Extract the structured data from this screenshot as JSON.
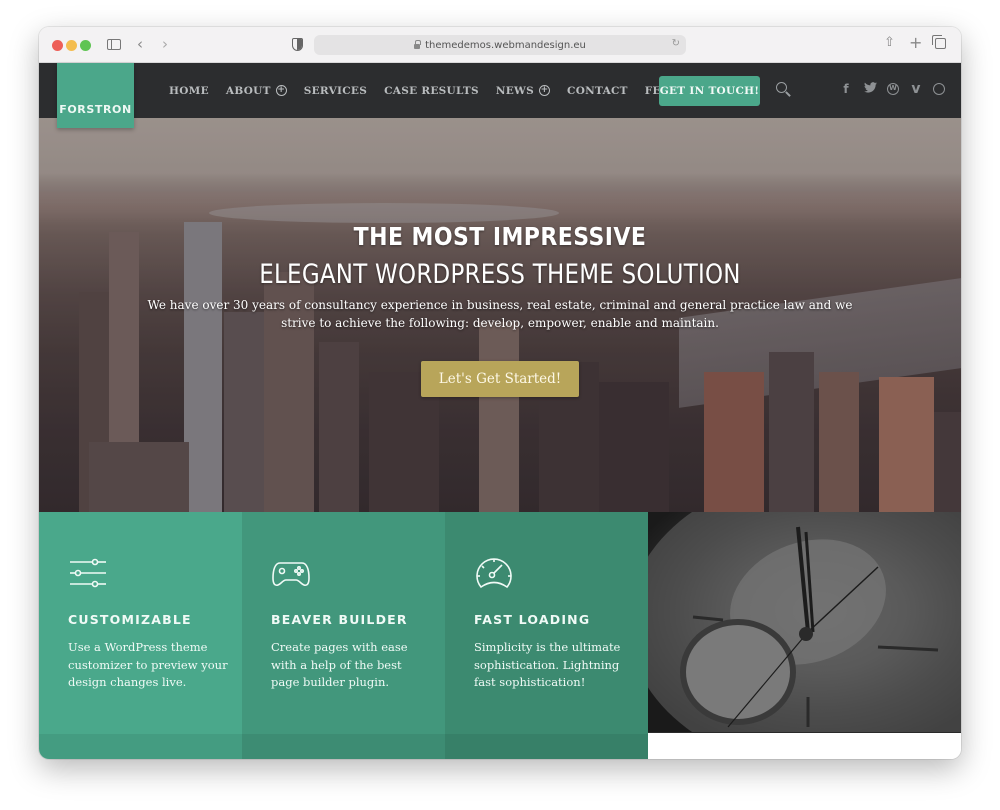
{
  "browser": {
    "url": "themedemos.webmandesign.eu",
    "icons": {
      "sidebar": "sidebar-toggle-icon",
      "back": "chevron-left-icon",
      "forward": "chevron-right-icon",
      "privacy": "shield-icon",
      "lock": "lock-icon",
      "reload": "reload-icon",
      "share": "share-icon",
      "new_tab": "plus-icon",
      "tabs": "tabs-overview-icon"
    },
    "glyphs": {
      "back": "‹",
      "forward": "›",
      "reload": "↻",
      "share": "⇧",
      "new_tab": "+"
    }
  },
  "header": {
    "logo": "FORSTRON",
    "nav": [
      {
        "label": "HOME",
        "has_submenu": false
      },
      {
        "label": "ABOUT",
        "has_submenu": true
      },
      {
        "label": "SERVICES",
        "has_submenu": false
      },
      {
        "label": "CASE RESULTS",
        "has_submenu": false
      },
      {
        "label": "NEWS",
        "has_submenu": true
      },
      {
        "label": "CONTACT",
        "has_submenu": false
      },
      {
        "label": "FEATURES",
        "has_submenu": true
      }
    ],
    "submenu_glyph": "+",
    "cta": "GET IN TOUCH!",
    "social": [
      {
        "name": "facebook",
        "glyph": "f"
      },
      {
        "name": "twitter",
        "glyph": "🐦"
      },
      {
        "name": "wordpress",
        "glyph": "W"
      },
      {
        "name": "vimeo",
        "glyph": "v"
      },
      {
        "name": "website",
        "glyph": "◎"
      }
    ]
  },
  "hero": {
    "title_line1": "THE MOST IMPRESSIVE",
    "title_line2": "ELEGANT WORDPRESS THEME SOLUTION",
    "text": "We have over 30 years of consultancy experience in business, real estate, criminal and general practice law and we strive to achieve the following: develop, empower, enable and maintain.",
    "cta": "Let's Get Started!"
  },
  "features": [
    {
      "icon": "sliders-icon",
      "title": "CUSTOMIZABLE",
      "text": "Use a WordPress theme customizer to preview your design changes live."
    },
    {
      "icon": "gamepad-icon",
      "title": "BEAVER BUILDER",
      "text": "Create pages with ease with a help of the best page builder plugin."
    },
    {
      "icon": "speedometer-icon",
      "title": "FAST LOADING",
      "text": "Simplicity is the ultimate sophistication. Lightning fast sophistication!"
    }
  ],
  "colors": {
    "brand_green": "#4ba78a",
    "header_bg": "#2c2d2f",
    "hero_cta": "#b8a55a"
  }
}
